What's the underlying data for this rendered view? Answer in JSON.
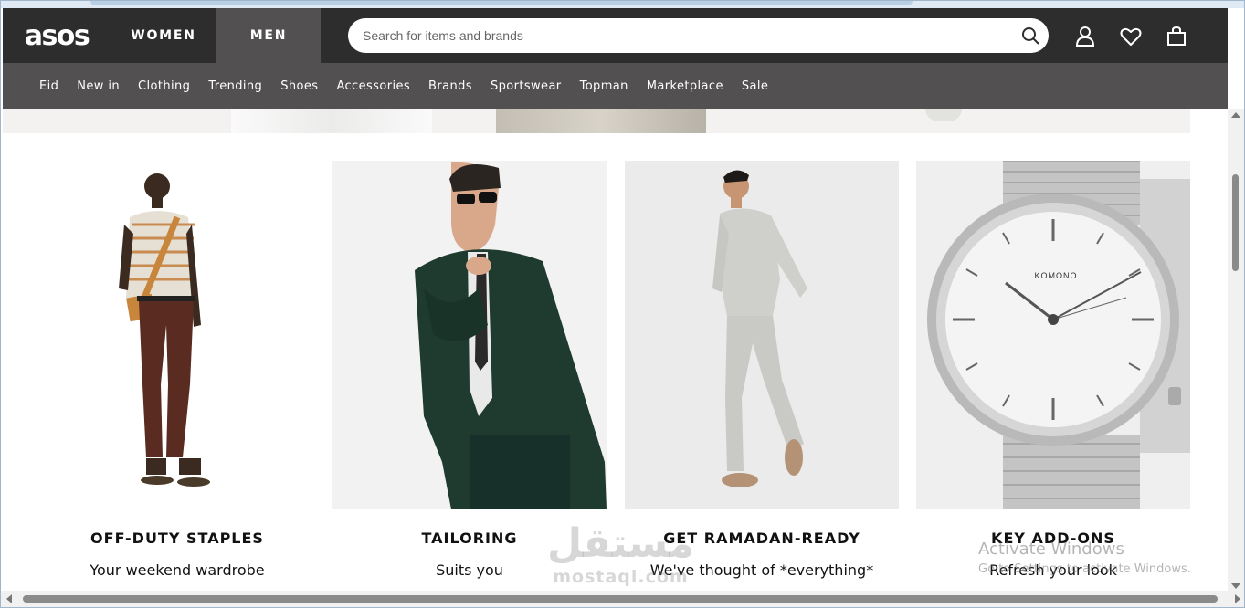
{
  "header": {
    "logo": "asos",
    "tabs": [
      {
        "label": "WOMEN",
        "active": false
      },
      {
        "label": "MEN",
        "active": true
      }
    ],
    "search": {
      "placeholder": "Search for items and brands"
    },
    "icons": [
      "account-icon",
      "heart-icon",
      "bag-icon"
    ]
  },
  "nav": {
    "items": [
      "Eid",
      "New in",
      "Clothing",
      "Trending",
      "Shoes",
      "Accessories",
      "Brands",
      "Sportswear",
      "Topman",
      "Marketplace",
      "Sale"
    ]
  },
  "cards": [
    {
      "title": "OFF-DUTY STAPLES",
      "subtitle": "Your weekend wardrobe"
    },
    {
      "title": "TAILORING",
      "subtitle": "Suits you"
    },
    {
      "title": "GET RAMADAN-READY",
      "subtitle": "We've thought of *everything*"
    },
    {
      "title": "KEY ADD-ONS",
      "subtitle": "Refresh your look"
    }
  ],
  "watch_brand": "KOMONO",
  "overlay": {
    "windows_title": "Activate Windows",
    "windows_sub": "Go to Settings to activate Windows.",
    "mostaql_ar": "مستقل",
    "mostaql_en": "mostaql.com"
  },
  "colors": {
    "header": "#2d2d2d",
    "nav": "#525050",
    "active_tab": "#525050"
  }
}
